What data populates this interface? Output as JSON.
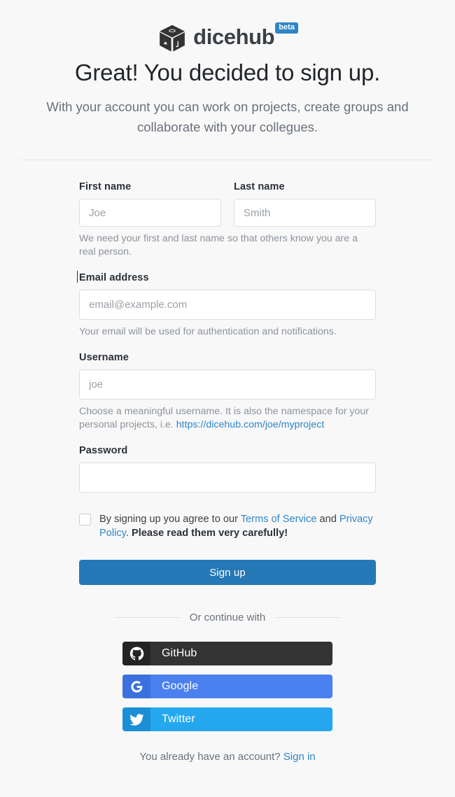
{
  "brand": {
    "name": "dicehub",
    "badge": "beta",
    "logo_icon": "dice-cube-icon",
    "logo_color": "#333333",
    "badge_color": "#2e86c7"
  },
  "header": {
    "headline": "Great! You decided to sign up.",
    "subhead": "With your account you can work on projects, create groups and collaborate with your collegues."
  },
  "form": {
    "first_name": {
      "label": "First name",
      "placeholder": "Joe",
      "value": ""
    },
    "last_name": {
      "label": "Last name",
      "placeholder": "Smith",
      "value": ""
    },
    "name_hint": "We need your first and last name so that others know you are a real person.",
    "email": {
      "label": "Email address",
      "placeholder": "email@example.com",
      "value": "",
      "hint": "Your email will be used for authentication and notifications."
    },
    "username": {
      "label": "Username",
      "placeholder": "joe",
      "value": "",
      "hint_prefix": "Choose a meaningful username. It is also the namespace for your personal projects, i.e. ",
      "hint_link": "https://dicehub.com/joe/myproject"
    },
    "password": {
      "label": "Password",
      "placeholder": "",
      "value": ""
    },
    "terms": {
      "prefix": "By signing up you agree to our ",
      "tos_link": "Terms of Service",
      "middle": " and ",
      "privacy_link": "Privacy Policy",
      "suffix_punct": ". ",
      "emphasis": "Please read them very carefully!",
      "checked": false
    },
    "submit_label": "Sign up"
  },
  "divider": {
    "or_text": "Or continue with"
  },
  "social_buttons": [
    {
      "label": "GitHub",
      "icon": "github-icon",
      "bg": "#333333",
      "icon_bg": "#242424"
    },
    {
      "label": "Google",
      "icon": "google-icon",
      "bg": "#4a80f0",
      "icon_bg": "#3b71de"
    },
    {
      "label": "Twitter",
      "icon": "twitter-icon",
      "bg": "#24a7ef",
      "icon_bg": "#1a8fd4"
    }
  ],
  "footer": {
    "question": "You already have an account? ",
    "signin_link": "Sign in"
  },
  "colors": {
    "accent": "#2478b5",
    "link": "#2e86c7",
    "page_bg": "#f8f8f9"
  }
}
